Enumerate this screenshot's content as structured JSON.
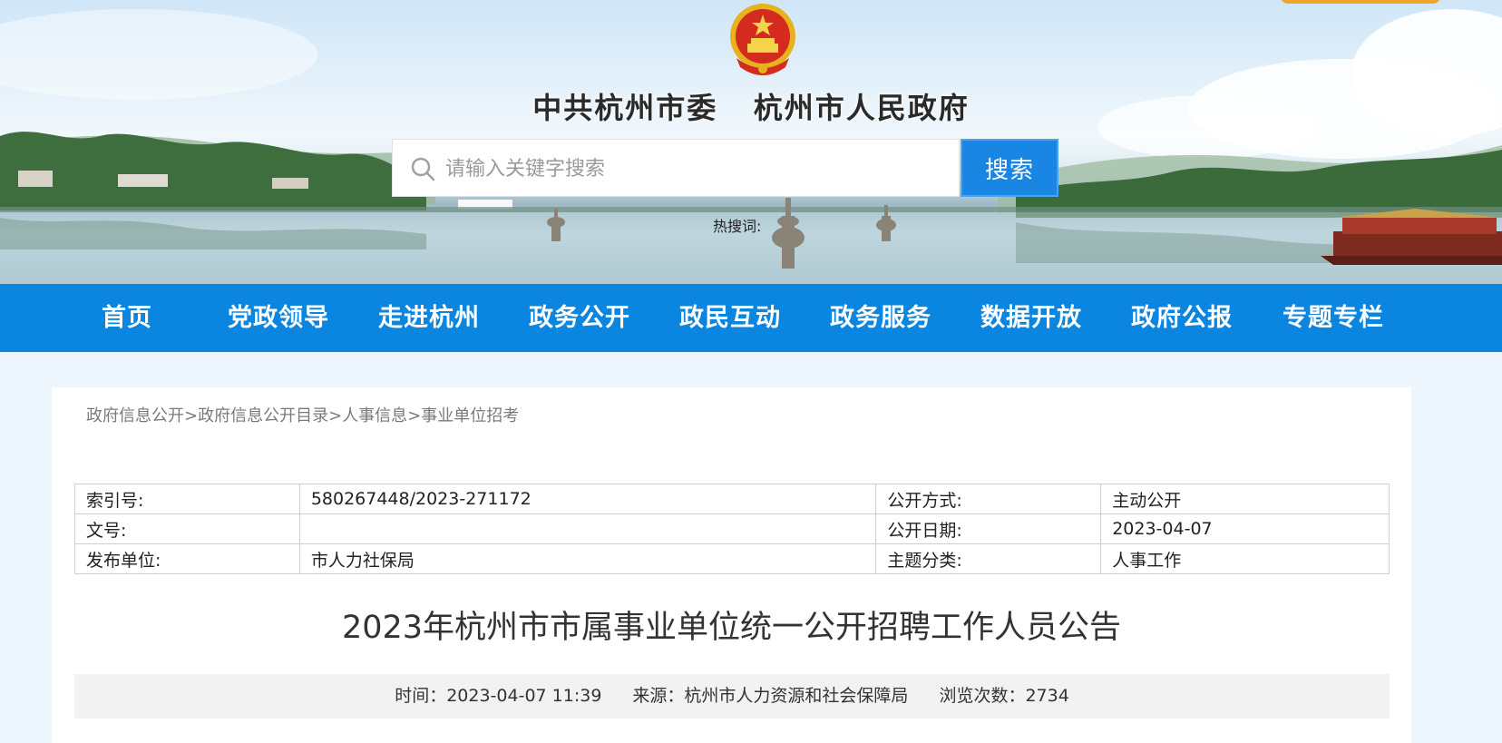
{
  "header": {
    "site_title": "中共杭州市委   杭州市人民政府",
    "search": {
      "placeholder": "请输入关键字搜索",
      "value": "",
      "button_label": "搜索"
    },
    "hot_label": "热搜词:"
  },
  "nav": {
    "items": [
      "首页",
      "党政领导",
      "走进杭州",
      "政务公开",
      "政民互动",
      "政务服务",
      "数据开放",
      "政府公报",
      "专题专栏"
    ]
  },
  "breadcrumb": [
    "政府信息公开",
    "政府信息公开目录",
    "人事信息",
    "事业单位招考"
  ],
  "breadcrumb_separator": ">",
  "meta": {
    "rows": [
      {
        "label1": "索引号:",
        "value1": "580267448/2023-271172",
        "label2": "公开方式:",
        "value2": "主动公开"
      },
      {
        "label1": "文号:",
        "value1": "",
        "label2": "公开日期:",
        "value2": "2023-04-07"
      },
      {
        "label1": "发布单位:",
        "value1": "市人力社保局",
        "label2": "主题分类:",
        "value2": "人事工作"
      }
    ]
  },
  "article": {
    "title": "2023年杭州市市属事业单位统一公开招聘工作人员公告",
    "time": "时间：2023-04-07 11:39",
    "source": "来源：杭州市人力资源和社会保障局",
    "views": "浏览次数：2734"
  },
  "colors": {
    "nav_blue": "#0b86e0",
    "search_button": "#1a86e4",
    "corner_tab": "#f0a42a",
    "page_bg": "#eef6fd"
  },
  "icons": [
    "national-emblem-icon",
    "search-icon"
  ]
}
